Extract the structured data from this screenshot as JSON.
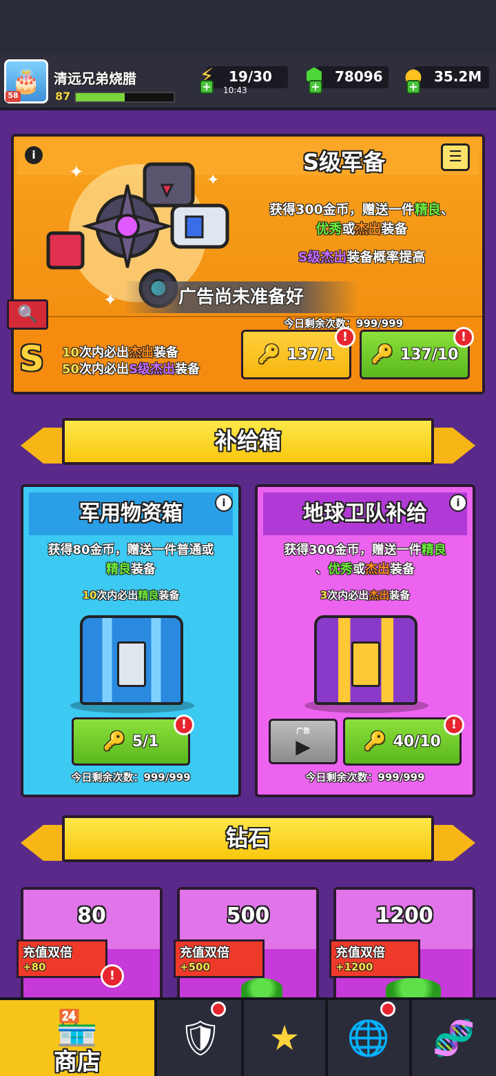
{
  "player": {
    "name": "清远兄弟烧腊",
    "avatar_level": "58",
    "level": "87",
    "xp_fraction": 0.5
  },
  "resources": {
    "energy": {
      "value": "19/30",
      "timer": "10:43",
      "icon": "lightning-icon"
    },
    "gems": {
      "value": "78096",
      "icon": "gem-icon"
    },
    "coins": {
      "value": "35.2M",
      "icon": "coin-icon"
    }
  },
  "s_pack": {
    "title": "S级军备",
    "desc_1": "获得300金币，赠送一件",
    "desc_q1": "精良",
    "desc_2": "、",
    "desc_q2": "优秀",
    "desc_3": "或",
    "desc_q3": "杰出",
    "desc_4": "装备",
    "rate_prefix": "S级",
    "rate_q": "杰出",
    "rate_suffix": "装备概率提高",
    "ad_not_ready": "广告尚未准备好",
    "today_left": "今日剩余次数：999/999",
    "guarantee_1_num": "10",
    "guarantee_1_mid": "次内必出",
    "guarantee_1_q": "杰出",
    "guarantee_1_end": "装备",
    "guarantee_2_num": "50",
    "guarantee_2_mid": "次内必出",
    "guarantee_2_q": "S级杰出",
    "guarantee_2_end": "装备",
    "btn_single": "137/1",
    "btn_ten": "137/10",
    "alert": "!"
  },
  "supply": {
    "section_title": "补给箱",
    "military": {
      "title": "军用物资箱",
      "desc_1": "获得80金币，赠送一件普通或",
      "desc_q": "精良",
      "desc_2": "装备",
      "guar_num": "10",
      "guar_mid": "次内必出",
      "guar_q": "精良",
      "guar_end": "装备",
      "btn": "5/1",
      "today_left": "今日剩余次数：999/999"
    },
    "earth": {
      "title": "地球卫队补给",
      "desc_1": "获得300金币，赠送一件",
      "desc_q1": "精良",
      "desc_2": "、",
      "desc_q2": "优秀",
      "desc_3": "或",
      "desc_q3": "杰出",
      "desc_4": "装备",
      "guar_num": "3",
      "guar_mid": "次内必出",
      "guar_q": "杰出",
      "guar_end": "装备",
      "ad_label": "广告",
      "btn": "40/10",
      "today_left": "今日剩余次数：999/999"
    }
  },
  "diamonds": {
    "section_title": "钻石",
    "offers": [
      {
        "amount": "80",
        "tag": "充值双倍",
        "bonus": "+80"
      },
      {
        "amount": "500",
        "tag": "充值双倍",
        "bonus": "+500"
      },
      {
        "amount": "1200",
        "tag": "充值双倍",
        "bonus": "+1200"
      }
    ]
  },
  "nav": {
    "shop_label": "商店"
  },
  "colors": {
    "orange_panel": "#f8a21c",
    "blue_card": "#3cc9f2",
    "pink_card": "#ec63ef",
    "button_green": "#5ab81e",
    "alert_red": "#e6252e"
  }
}
